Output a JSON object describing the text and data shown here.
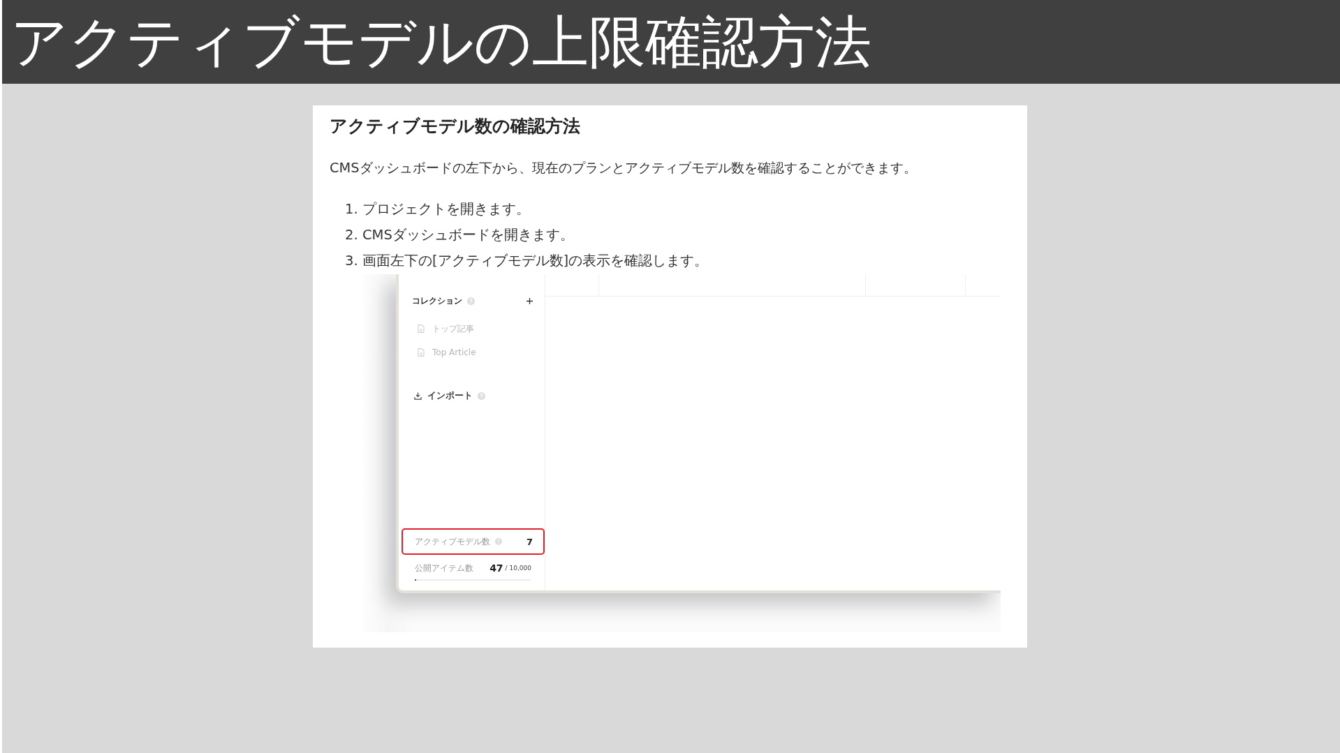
{
  "slide": {
    "title": "アクティブモデルの上限確認方法"
  },
  "card": {
    "heading": "アクティブモデル数の確認方法",
    "intro": "CMSダッシュボードの左下から、現在のプランとアクティブモデル数を確認することができます。",
    "steps": [
      "1. プロジェクトを開きます。",
      "2. CMSダッシュボードを開きます。",
      "3. 画面左下の[アクティブモデル数]の表示を確認します。"
    ]
  },
  "screenshot": {
    "sidebar": {
      "collections": {
        "label": "コレクション",
        "items": [
          "トップ記事",
          "Top Article"
        ]
      },
      "import": {
        "label": "インポート"
      },
      "stats": [
        {
          "kind": "count",
          "label": "アクティブモデル数",
          "value": "7",
          "highlighted": true
        },
        {
          "kind": "quota",
          "label": "公開アイテム数",
          "value": "47",
          "limit": "/ 10,000",
          "level": 0.005,
          "highlighted": false
        }
      ]
    }
  }
}
